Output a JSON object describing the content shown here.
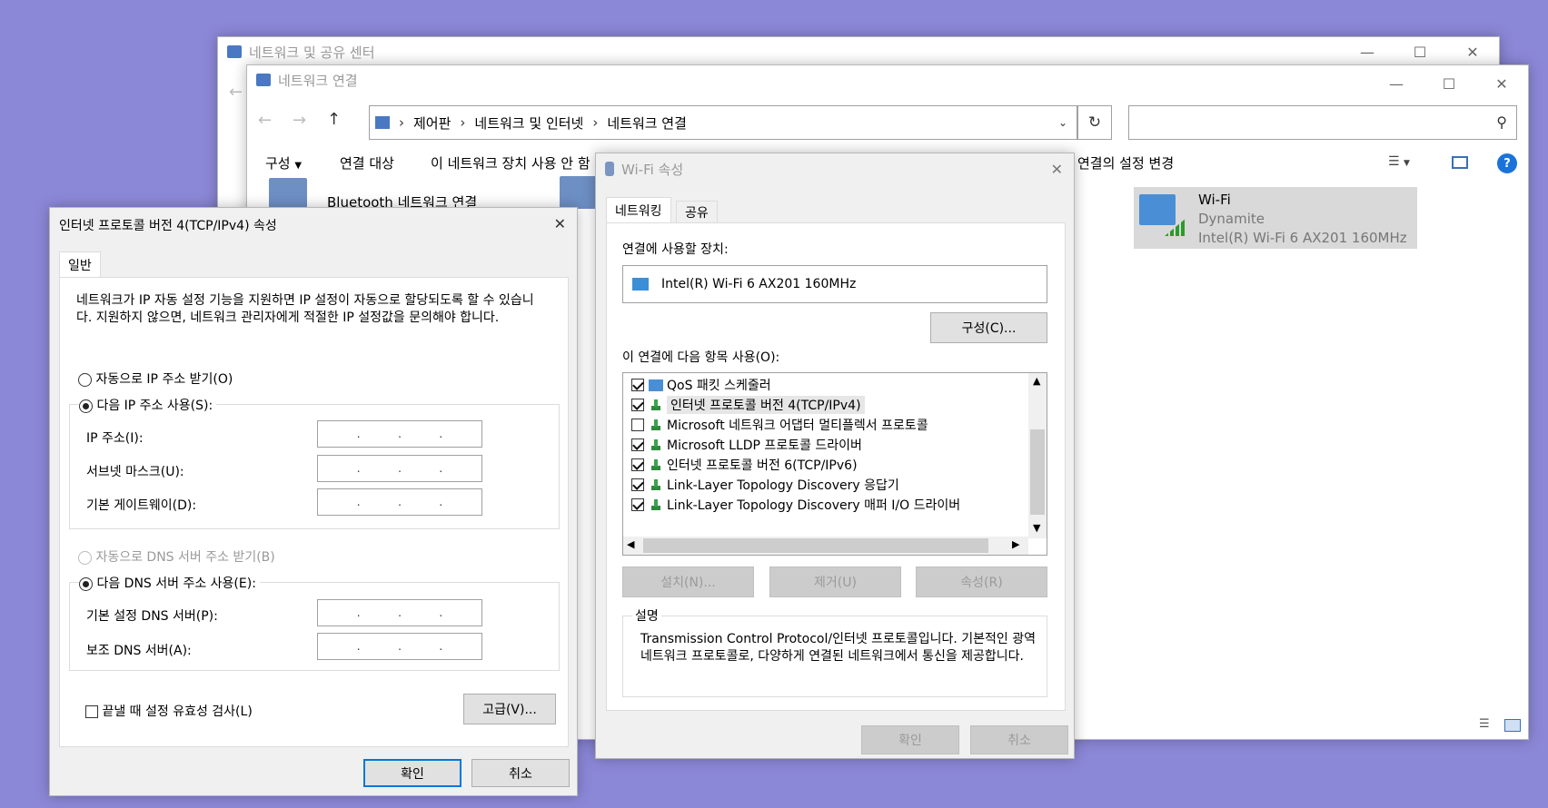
{
  "network_center": {
    "title": "네트워크 및 공유 센터"
  },
  "network_connections": {
    "title": "네트워크 연결",
    "breadcrumb": [
      "제어판",
      "네트워크 및 인터넷",
      "네트워크 연결"
    ],
    "search_placeholder": "",
    "toolbar": {
      "organize": "구성",
      "connect_to": "연결 대상",
      "diagnose": "이 네트워크 장치 사용 안 함",
      "change_settings": "연결의 설정 변경"
    },
    "adapters": [
      {
        "name": "Bluetooth 네트워크 연결"
      },
      {
        "name": "Wi-Fi",
        "network": "Dynamite",
        "device": "Intel(R) Wi-Fi 6 AX201 160MHz"
      }
    ]
  },
  "wifi_props": {
    "title": "Wi-Fi 속성",
    "tabs": [
      "네트워킹",
      "공유"
    ],
    "connect_using_label": "연결에 사용할 장치:",
    "device": "Intel(R) Wi-Fi 6 AX201 160MHz",
    "configure_button": "구성(C)...",
    "items_label": "이 연결에 다음 항목 사용(O):",
    "items": [
      {
        "label": "QoS 패킷 스케줄러",
        "checked": true
      },
      {
        "label": "인터넷 프로토콜 버전 4(TCP/IPv4)",
        "checked": true
      },
      {
        "label": "Microsoft 네트워크 어댑터 멀티플렉서 프로토콜",
        "checked": false
      },
      {
        "label": "Microsoft LLDP 프로토콜 드라이버",
        "checked": true
      },
      {
        "label": "인터넷 프로토콜 버전 6(TCP/IPv6)",
        "checked": true
      },
      {
        "label": "Link-Layer Topology Discovery 응답기",
        "checked": true
      },
      {
        "label": "Link-Layer Topology Discovery 매퍼 I/O 드라이버",
        "checked": true
      }
    ],
    "install_button": "설치(N)...",
    "uninstall_button": "제거(U)",
    "properties_button": "속성(R)",
    "description_label": "설명",
    "description": "Transmission Control Protocol/인터넷 프로토콜입니다. 기본적인 광역 네트워크 프로토콜로, 다양하게 연결된 네트워크에서 통신을 제공합니다.",
    "ok_button": "확인",
    "cancel_button": "취소"
  },
  "ipv4_props": {
    "title": "인터넷 프로토콜 버전 4(TCP/IPv4) 속성",
    "tab": "일반",
    "intro": "네트워크가 IP 자동 설정 기능을 지원하면 IP 설정이 자동으로 할당되도록 할 수 있습니다. 지원하지 않으면, 네트워크 관리자에게 적절한 IP 설정값을 문의해야 합니다.",
    "auto_ip": "자동으로 IP 주소 받기(O)",
    "manual_ip": "다음 IP 주소 사용(S):",
    "ip_label": "IP 주소(I):",
    "subnet_label": "서브넷 마스크(U):",
    "gateway_label": "기본 게이트웨이(D):",
    "auto_dns": "자동으로 DNS 서버 주소 받기(B)",
    "manual_dns": "다음 DNS 서버 주소 사용(E):",
    "dns_primary_label": "기본 설정 DNS 서버(P):",
    "dns_alt_label": "보조 DNS 서버(A):",
    "validate_label": "끝낼 때 설정 유효성 검사(L)",
    "advanced_button": "고급(V)...",
    "ok_button": "확인",
    "cancel_button": "취소"
  }
}
